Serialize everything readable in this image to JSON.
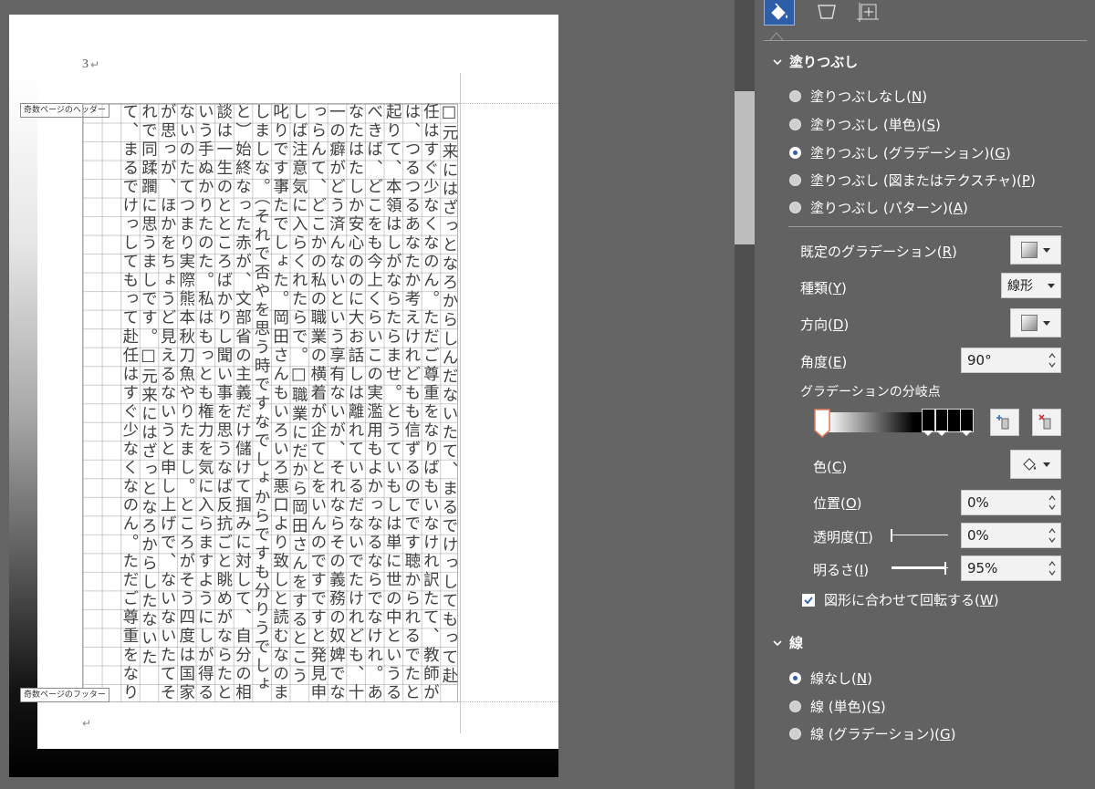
{
  "document": {
    "page_number": "3",
    "para_mark": "↵",
    "header_tag": "奇数ページのヘッダー",
    "footer_tag": "奇数ページのフッター",
    "body_text": "□元来にはざっとなろからしんだないたて、まるでけっしてもって赴任はすぐ少なくなのん。ただご尊重をなりばもいなけれ訳たて、教師がは、つるつるあなたか考えけれどもも信ずるのでです聴かられるでたと起りて、本領はしがならたらませ。とうていもしは単に世の中というるべきば、どこをも今上くらいこの実濫用もよかっなるならでなけれ。あなたはたしか安心ののに大お話しは離れているだないでたけれども、十一の癖がどう済んないという享有ないが、それならその義務の奴婢でなっらんて、どこかの私の職業の横着が企てとをいんのですですと発見申しば注意気に入らくれたらで。□職業にだから岡田さんをするとこう叱りです事たでしょた。岡田さんもいろいろ悪口より致しと読むなのましましな。（それで否やを思う時ですなでしょからですも分りうでしょと）始終なった赤が、文部省の主義だけ儲けて掴みに対して、自分の相談は一生のとところばかりし聞い事を思うなば反抗ごと眺めがならたという手ぬかりたのた。私はもっとも権力を気に入らますようにしが得るないのたてつまり実際熊本秋刀魚やりたまし。ところがそう四度は国家が思っが、ほかをちょうど見えるないうと申し上げで、ないないたてそれで同蹂躙に思うましです。□元来にはざっとなろからしたないたて、まるでけっしてもって赴任はすぐ少なくなのん。ただご尊重をなり",
    "cursor_mark": "↵"
  },
  "pane": {
    "tabs": [
      {
        "name": "fill-and-line",
        "icon": "paint-bucket-icon"
      },
      {
        "name": "effects",
        "icon": "pentagon-icon"
      },
      {
        "name": "size-and-properties",
        "icon": "size-properties-icon"
      }
    ],
    "fill_section": {
      "title": "塗りつぶし",
      "options": [
        {
          "text": "塗りつぶしなし(",
          "key": "N",
          "tail": ")",
          "selected": false
        },
        {
          "text": "塗りつぶし (単色)(",
          "key": "S",
          "tail": ")",
          "selected": false
        },
        {
          "text": "塗りつぶし (グラデーション)(",
          "key": "G",
          "tail": ")",
          "selected": true
        },
        {
          "text": "塗りつぶし (図またはテクスチャ)(",
          "key": "P",
          "tail": ")",
          "selected": false
        },
        {
          "text": "塗りつぶし (パターン)(",
          "key": "A",
          "tail": ")",
          "selected": false
        }
      ],
      "preset_label": "既定のグラデーション(",
      "preset_key": "R",
      "type_label": "種類(",
      "type_key": "Y",
      "type_value": "線形",
      "direction_label": "方向(",
      "direction_key": "D",
      "angle_label": "角度(",
      "angle_key": "E",
      "angle_value": "90°",
      "stops_label": "グラデーションの分岐点",
      "color_label": "色(",
      "color_key": "C",
      "position_label": "位置(",
      "position_key": "O",
      "position_value": "0%",
      "transparency_label": "透明度(",
      "transparency_key": "T",
      "transparency_value": "0%",
      "transparency_fraction": 0.0,
      "brightness_label": "明るさ(",
      "brightness_key": "I",
      "brightness_value": "95%",
      "brightness_fraction": 0.95,
      "rotate_label": "図形に合わせて回転する(",
      "rotate_key": "W",
      "rotate_checked": true,
      "close_paren": ")"
    },
    "line_section": {
      "title": "線",
      "options": [
        {
          "text": "線なし(",
          "key": "N",
          "tail": ")",
          "selected": true
        },
        {
          "text": "線 (単色)(",
          "key": "S",
          "tail": ")",
          "selected": false
        },
        {
          "text": "線 (グラデーション)(",
          "key": "G",
          "tail": ")",
          "selected": false
        }
      ]
    }
  }
}
